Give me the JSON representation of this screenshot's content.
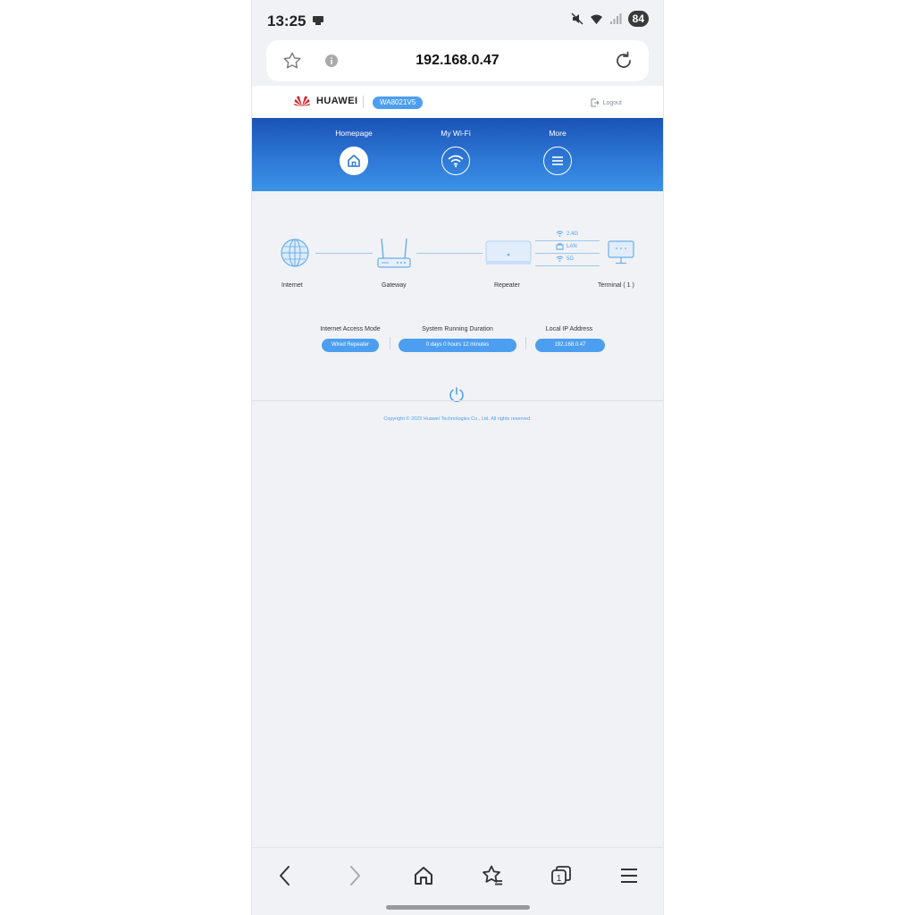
{
  "status_bar": {
    "time": "13:25",
    "battery": "84"
  },
  "browser": {
    "url": "192.168.0.47"
  },
  "router": {
    "brand": "HUAWEI",
    "model": "WA8021V5",
    "logout": "Logout",
    "nav": [
      {
        "label": "Homepage",
        "icon": "home-icon"
      },
      {
        "label": "My Wi-Fi",
        "icon": "wifi-icon"
      },
      {
        "label": "More",
        "icon": "menu-icon"
      }
    ],
    "topology": {
      "internet": "Internet",
      "gateway": "Gateway",
      "repeater": "Repeater",
      "terminal": "Terminal ( 1 )",
      "bands": [
        "2.4G",
        "LAN",
        "5G"
      ]
    },
    "info": {
      "access_mode_title": "Internet Access Mode",
      "access_mode_value": "Wired Repeater",
      "duration_title": "System Running Duration",
      "duration_value": "0 days 0 hours 12 minutes",
      "ip_title": "Local IP Address",
      "ip_value": "192.168.0.47"
    },
    "copyright": "Copyright © 2023 Huawei Technologies Co., Ltd. All rights reserved."
  },
  "colors": {
    "accent": "#4c9ff0",
    "banner_top": "#1a53b5",
    "banner_bottom": "#3b93e6"
  }
}
